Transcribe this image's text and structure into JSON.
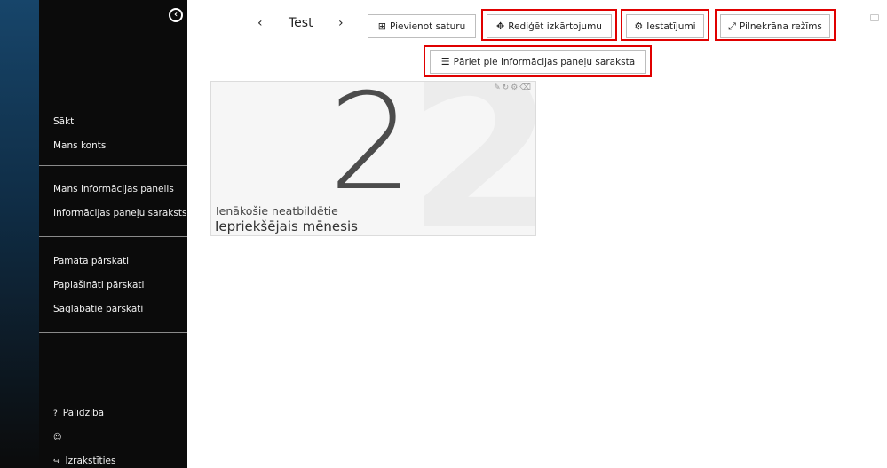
{
  "sidebar": {
    "items_top": [
      {
        "label": "Sākt"
      },
      {
        "label": "Mans konts"
      }
    ],
    "items_mid": [
      {
        "label": "Mans informācijas panelis"
      },
      {
        "label": "Informācijas paneļu saraksts"
      }
    ],
    "items_reports": [
      {
        "label": "Pamata pārskati"
      },
      {
        "label": "Paplašināti pārskati"
      },
      {
        "label": "Saglabātie pārskati"
      }
    ],
    "help_label": "Palīdzība",
    "logout_label": "Izrakstīties"
  },
  "toolbar": {
    "prev": "‹",
    "next": "›",
    "dashboard_title": "Test",
    "add_content": "Pievienot saturu",
    "edit_layout": "Rediģēt izkārtojumu",
    "settings": "Iestatījumi",
    "fullscreen": "Pilnekrāna režīms",
    "go_to_list": "Pāriet pie informācijas paneļu saraksta"
  },
  "widget": {
    "value": "2",
    "label": "Ienākošie neatbildētie",
    "period": "Iepriekšējais mēnesis"
  },
  "colors": {
    "highlight": "#e00000",
    "sidebar_bg": "#0b0b0b",
    "sidebar_accent": "#17456a"
  }
}
